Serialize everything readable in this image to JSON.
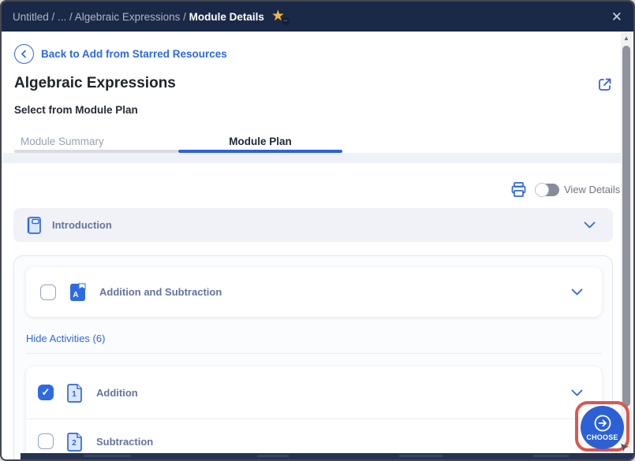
{
  "header": {
    "breadcrumb": "Untitled / ... / Algebraic Expressions /",
    "current": "Module Details",
    "close_label": "✕",
    "star_icon": "starred-with-remove-badge",
    "star_badge": "−"
  },
  "nav": {
    "back_label": "Back to Add from Starred Resources"
  },
  "page": {
    "title": "Algebraic Expressions",
    "subtitle": "Select from Module Plan"
  },
  "tabs": {
    "summary": "Module Summary",
    "plan": "Module Plan",
    "active_tab": "Module Plan"
  },
  "toolbar": {
    "view_details": "View Details",
    "toggle_state": "off"
  },
  "module": {
    "introduction": "Introduction",
    "unit": "Addition and Subtraction",
    "unit_checked": false,
    "hide_activities": "Hide Activities (6)",
    "activities": [
      {
        "num": "1",
        "label": "Addition",
        "checked": true
      },
      {
        "num": "2",
        "label": "Subtraction",
        "checked": false
      }
    ]
  },
  "choose": {
    "label": "CHOOSE"
  },
  "colors": {
    "header_navy": "#1A2947",
    "accent_blue": "#2E68DD",
    "tab_underline_blue": "#2E62D9",
    "checkbox_blue": "#2E6BE0",
    "annotation_red": "#DC574D",
    "row_bg": "#F0F2F7"
  }
}
